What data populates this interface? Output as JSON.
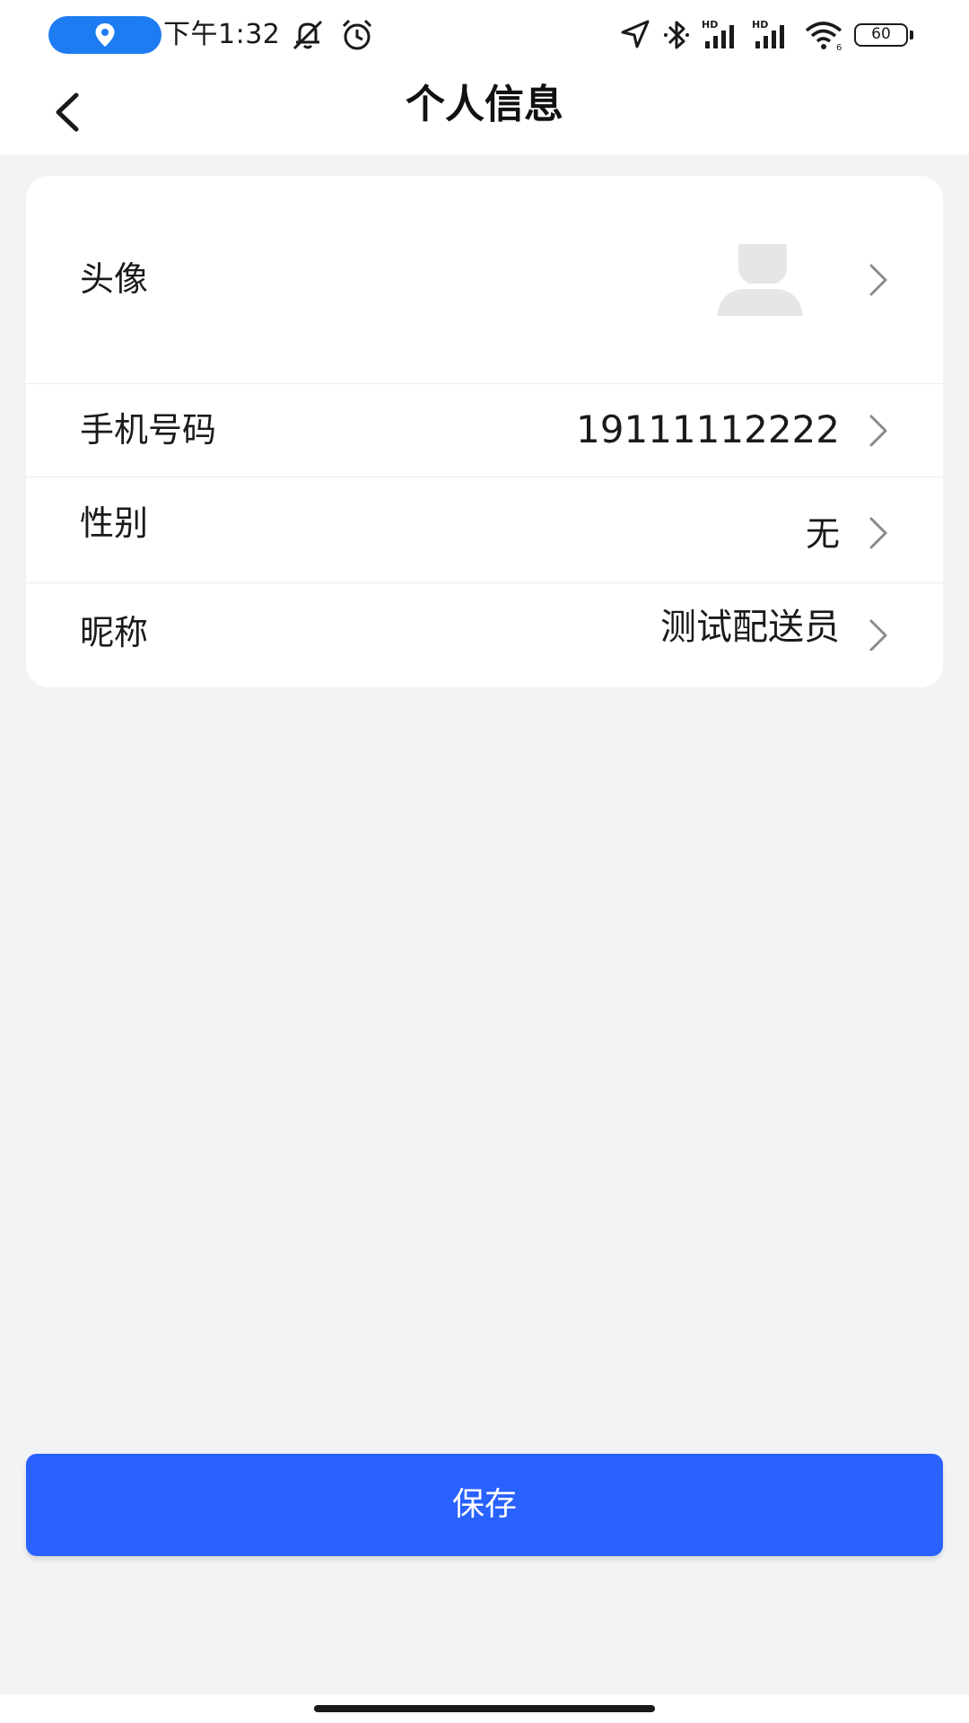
{
  "status_bar": {
    "time": "下午1:32",
    "battery": "60",
    "icons": [
      "location-pin-icon",
      "bell-off-icon",
      "alarm-clock-icon",
      "navigation-arrow-icon",
      "bluetooth-icon",
      "signal-hd-icon",
      "signal-hd-icon",
      "wifi-icon",
      "battery-icon"
    ]
  },
  "nav": {
    "title": "个人信息",
    "back_icon": "chevron-left-icon"
  },
  "profile": {
    "rows": [
      {
        "label": "头像",
        "value": "",
        "type": "avatar"
      },
      {
        "label": "手机号码",
        "value": "19111112222"
      },
      {
        "label": "性别",
        "value": "无"
      },
      {
        "label": "昵称",
        "value": "测试配送员"
      }
    ]
  },
  "actions": {
    "save_label": "保存"
  },
  "colors": {
    "primary": "#2962ff",
    "background": "#f2f3f5",
    "location_pill": "#1e7cf2"
  }
}
